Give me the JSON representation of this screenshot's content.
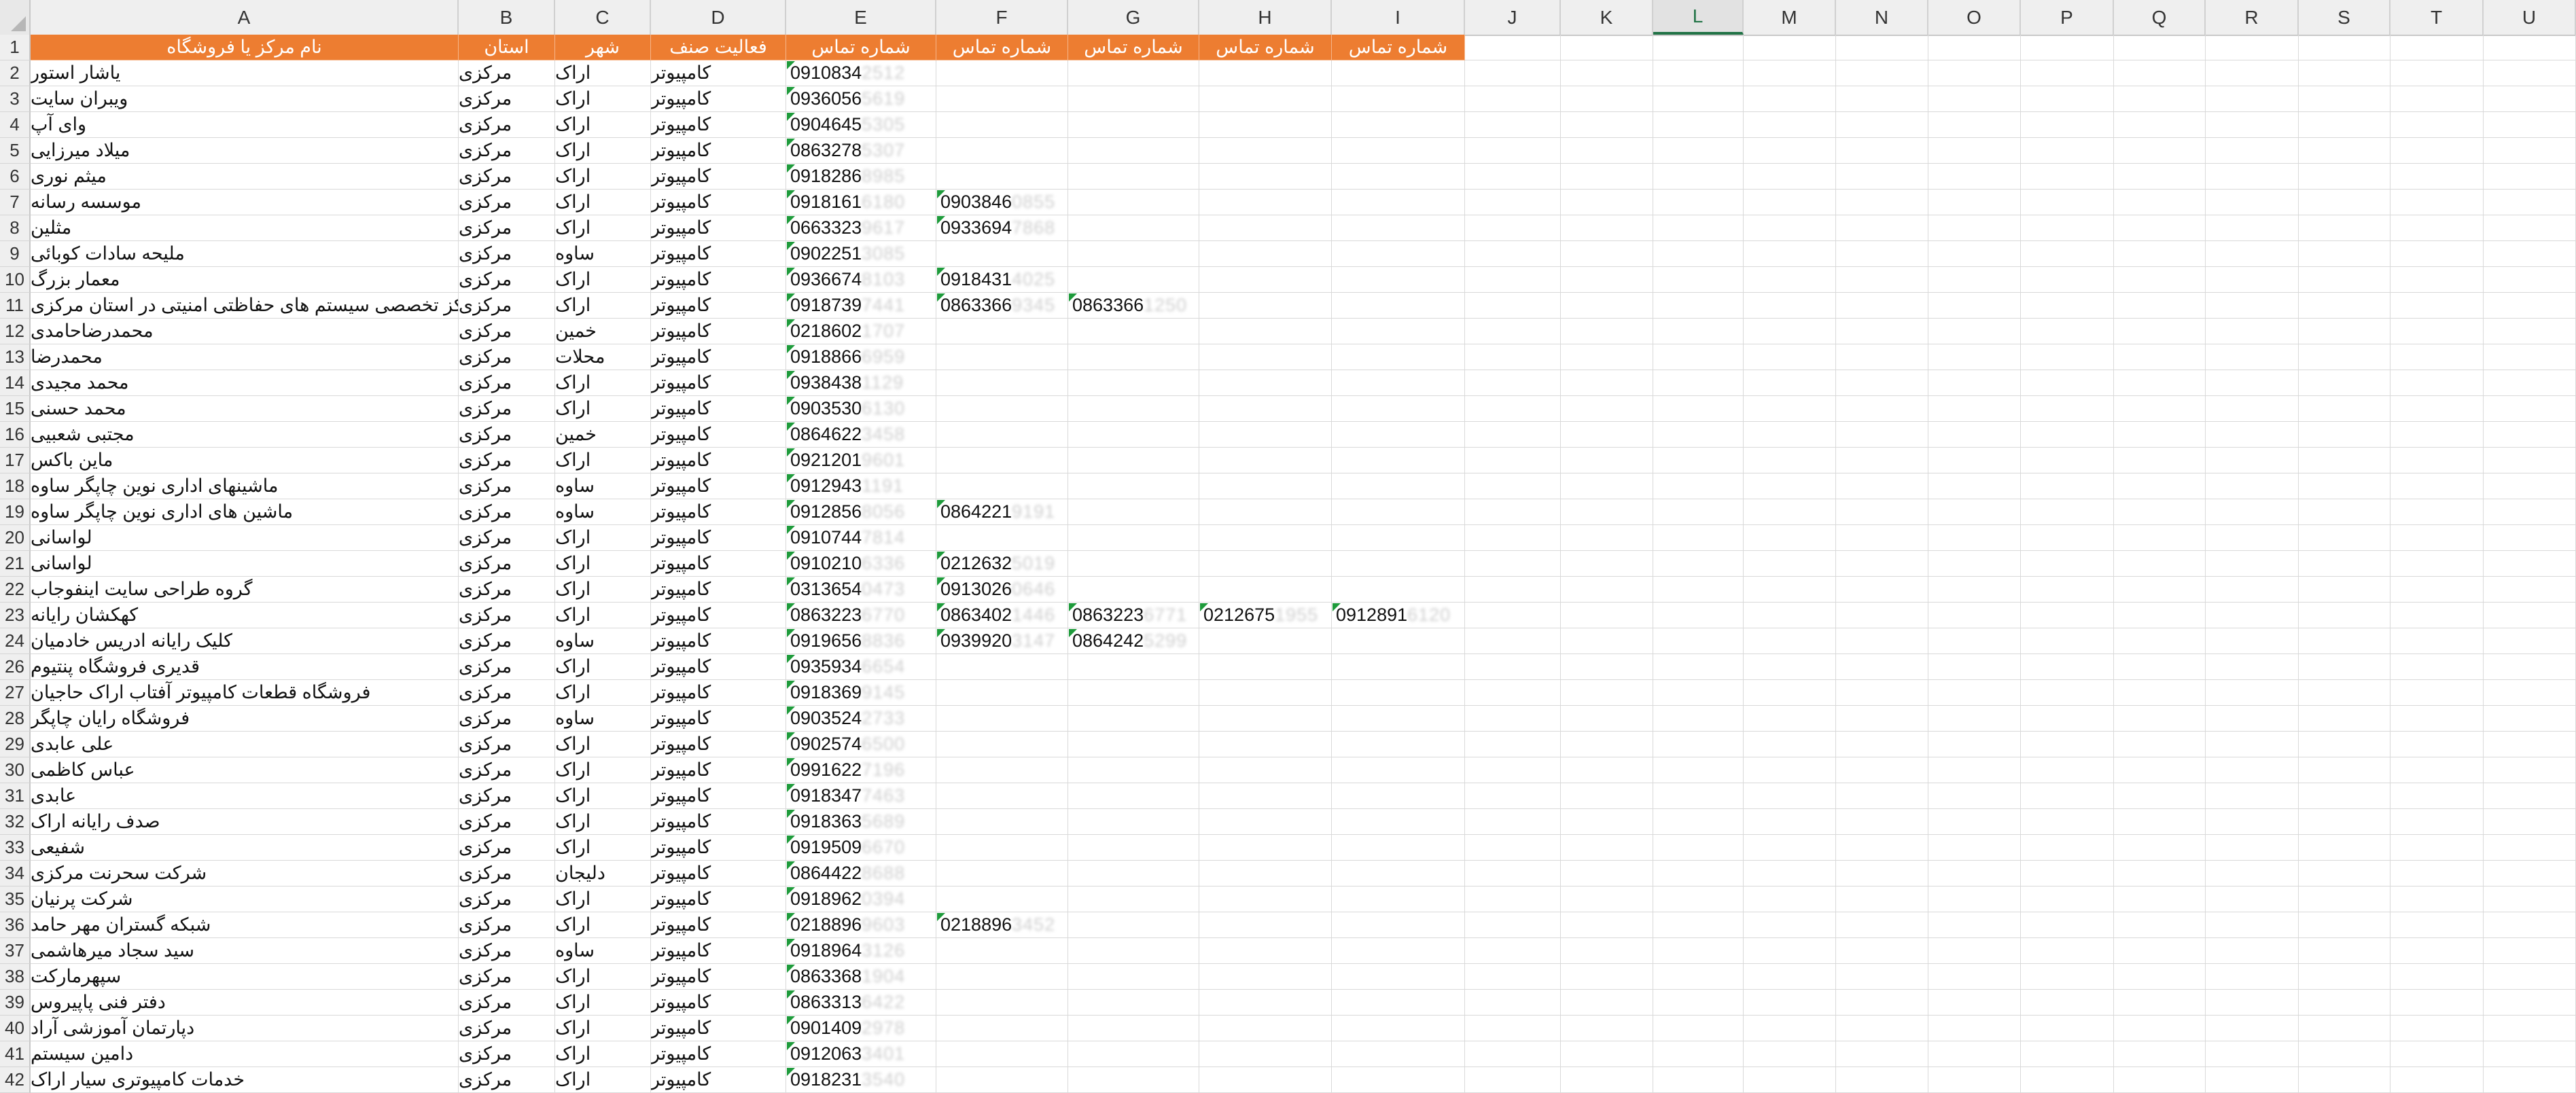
{
  "columns": [
    "A",
    "B",
    "C",
    "D",
    "E",
    "F",
    "G",
    "H",
    "I",
    "J",
    "K",
    "L",
    "M",
    "N",
    "O",
    "P",
    "Q",
    "R",
    "S",
    "T",
    "U"
  ],
  "selected_column": "L",
  "colors": {
    "header_fill": "#ed7d31",
    "header_text": "#ffffff",
    "indicator": "#1e9b3b",
    "selected": "#217346"
  },
  "header_row": [
    "نام مرکز یا فروشگاه",
    "استان",
    "شهر",
    "فعالیت صنف",
    "شماره تماس",
    "شماره تماس",
    "شماره تماس",
    "شماره تماس",
    "شماره تماس"
  ],
  "rows": [
    {
      "n": "2",
      "name": "یاشار استور",
      "prov": "مرکزی",
      "city": "اراک",
      "act": "کامپیوتر",
      "phones": [
        [
          "0910834",
          "2512"
        ]
      ]
    },
    {
      "n": "3",
      "name": "ویبران سایت",
      "prov": "مرکزی",
      "city": "اراک",
      "act": "کامپیوتر",
      "phones": [
        [
          "0936056",
          "5619"
        ]
      ]
    },
    {
      "n": "4",
      "name": "وای آپ",
      "prov": "مرکزی",
      "city": "اراک",
      "act": "کامپیوتر",
      "phones": [
        [
          "0904645",
          "5305"
        ]
      ]
    },
    {
      "n": "5",
      "name": "میلاد میرزایی",
      "prov": "مرکزی",
      "city": "اراک",
      "act": "کامپیوتر",
      "phones": [
        [
          "0863278",
          "5307"
        ]
      ]
    },
    {
      "n": "6",
      "name": "میثم نوری",
      "prov": "مرکزی",
      "city": "اراک",
      "act": "کامپیوتر",
      "phones": [
        [
          "0918286",
          "8985"
        ]
      ]
    },
    {
      "n": "7",
      "name": "موسسه رسانه",
      "prov": "مرکزی",
      "city": "اراک",
      "act": "کامپیوتر",
      "phones": [
        [
          "0918161",
          "6180"
        ],
        [
          "0903846",
          "0855"
        ]
      ]
    },
    {
      "n": "8",
      "name": "مثلین",
      "prov": "مرکزی",
      "city": "اراک",
      "act": "کامپیوتر",
      "phones": [
        [
          "0663323",
          "9617"
        ],
        [
          "0933694",
          "7868"
        ]
      ]
    },
    {
      "n": "9",
      "name": "ملیحه سادات کوبائی",
      "prov": "مرکزی",
      "city": "ساوه",
      "act": "کامپیوتر",
      "phones": [
        [
          "0902251",
          "3085"
        ]
      ]
    },
    {
      "n": "10",
      "name": "معمار بزرگ",
      "prov": "مرکزی",
      "city": "اراک",
      "act": "کامپیوتر",
      "phones": [
        [
          "0936674",
          "8103"
        ],
        [
          "0918431",
          "4025"
        ]
      ]
    },
    {
      "n": "11",
      "name": "مرکز تخصصی سیستم های حفاظتی امنیتی در استان مرکزی",
      "prov": "مرکزی",
      "city": "اراک",
      "act": "کامپیوتر",
      "phones": [
        [
          "0918739",
          "7441"
        ],
        [
          "0863366",
          "9345"
        ],
        [
          "0863366",
          "1250"
        ]
      ]
    },
    {
      "n": "12",
      "name": "محمدرضاحامدی",
      "prov": "مرکزی",
      "city": "خمین",
      "act": "کامپیوتر",
      "phones": [
        [
          "0218602",
          "1707"
        ]
      ]
    },
    {
      "n": "13",
      "name": "محمدرضا",
      "prov": "مرکزی",
      "city": "محلات",
      "act": "کامپیوتر",
      "phones": [
        [
          "0918866",
          "6959"
        ]
      ]
    },
    {
      "n": "14",
      "name": "محمد مجیدی",
      "prov": "مرکزی",
      "city": "اراک",
      "act": "کامپیوتر",
      "phones": [
        [
          "0938438",
          "1129"
        ]
      ]
    },
    {
      "n": "15",
      "name": "محمد حسنی",
      "prov": "مرکزی",
      "city": "اراک",
      "act": "کامپیوتر",
      "phones": [
        [
          "0903530",
          "6130"
        ]
      ]
    },
    {
      "n": "16",
      "name": "مجتبی شعبیی",
      "prov": "مرکزی",
      "city": "خمین",
      "act": "کامپیوتر",
      "phones": [
        [
          "0864622",
          "3458"
        ]
      ]
    },
    {
      "n": "17",
      "name": "ماین باکس",
      "prov": "مرکزی",
      "city": "اراک",
      "act": "کامپیوتر",
      "phones": [
        [
          "0921201",
          "9601"
        ]
      ]
    },
    {
      "n": "18",
      "name": "ماشینهای اداری نوین چاپگر ساوه",
      "prov": "مرکزی",
      "city": "ساوه",
      "act": "کامپیوتر",
      "phones": [
        [
          "0912943",
          "1191"
        ]
      ]
    },
    {
      "n": "19",
      "name": "ماشین های اداری نوین چاپگر ساوه",
      "prov": "مرکزی",
      "city": "ساوه",
      "act": "کامپیوتر",
      "phones": [
        [
          "0912856",
          "8056"
        ],
        [
          "0864221",
          "9191"
        ]
      ]
    },
    {
      "n": "20",
      "name": "لواسانی",
      "prov": "مرکزی",
      "city": "اراک",
      "act": "کامپیوتر",
      "phones": [
        [
          "0910744",
          "7814"
        ]
      ]
    },
    {
      "n": "21",
      "name": "لواسانی",
      "prov": "مرکزی",
      "city": "اراک",
      "act": "کامپیوتر",
      "phones": [
        [
          "0910210",
          "6336"
        ],
        [
          "0212632",
          "5019"
        ]
      ]
    },
    {
      "n": "22",
      "name": "گروه طراحی سایت اینفوجاب",
      "prov": "مرکزی",
      "city": "اراک",
      "act": "کامپیوتر",
      "phones": [
        [
          "0313654",
          "0473"
        ],
        [
          "0913026",
          "0646"
        ]
      ]
    },
    {
      "n": "23",
      "name": "کهکشان رایانه",
      "prov": "مرکزی",
      "city": "اراک",
      "act": "کامپیوتر",
      "phones": [
        [
          "0863223",
          "6770"
        ],
        [
          "0863402",
          "1446"
        ],
        [
          "0863223",
          "6771"
        ],
        [
          "0212675",
          "1955"
        ],
        [
          "0912891",
          "6120"
        ]
      ]
    },
    {
      "n": "24",
      "name": "کلیک رایانه ادریس خادمیان",
      "prov": "مرکزی",
      "city": "ساوه",
      "act": "کامپیوتر",
      "phones": [
        [
          "0919656",
          "8836"
        ],
        [
          "0939920",
          "3147"
        ],
        [
          "0864242",
          "5299"
        ]
      ]
    },
    {
      "n": "26",
      "name": "قدیری فروشگاه پنتیوم",
      "prov": "مرکزی",
      "city": "اراک",
      "act": "کامپیوتر",
      "phones": [
        [
          "0935934",
          "6654"
        ]
      ]
    },
    {
      "n": "27",
      "name": "فروشگاه قطعات کامپیوتر آفتاب اراک حاجیان",
      "prov": "مرکزی",
      "city": "اراک",
      "act": "کامپیوتر",
      "phones": [
        [
          "0918369",
          "9145"
        ]
      ]
    },
    {
      "n": "28",
      "name": "فروشگاه رایان چاپگر",
      "prov": "مرکزی",
      "city": "ساوه",
      "act": "کامپیوتر",
      "phones": [
        [
          "0903524",
          "2733"
        ]
      ]
    },
    {
      "n": "29",
      "name": "علی عابدی",
      "prov": "مرکزی",
      "city": "اراک",
      "act": "کامپیوتر",
      "phones": [
        [
          "0902574",
          "6500"
        ]
      ]
    },
    {
      "n": "30",
      "name": "عباس کاظمی",
      "prov": "مرکزی",
      "city": "اراک",
      "act": "کامپیوتر",
      "phones": [
        [
          "0991622",
          "7196"
        ]
      ]
    },
    {
      "n": "31",
      "name": "عابدی",
      "prov": "مرکزی",
      "city": "اراک",
      "act": "کامپیوتر",
      "phones": [
        [
          "0918347",
          "7463"
        ]
      ]
    },
    {
      "n": "32",
      "name": "صدف رایانه اراک",
      "prov": "مرکزی",
      "city": "اراک",
      "act": "کامپیوتر",
      "phones": [
        [
          "0918363",
          "5689"
        ]
      ]
    },
    {
      "n": "33",
      "name": "شفیعی",
      "prov": "مرکزی",
      "city": "اراک",
      "act": "کامپیوتر",
      "phones": [
        [
          "0919509",
          "6670"
        ]
      ]
    },
    {
      "n": "34",
      "name": "شرکت سحرنت  مرکزی",
      "prov": "مرکزی",
      "city": "دلیجان",
      "act": "کامپیوتر",
      "phones": [
        [
          "0864422",
          "8688"
        ]
      ]
    },
    {
      "n": "35",
      "name": "شرکت پرنیان",
      "prov": "مرکزی",
      "city": "اراک",
      "act": "کامپیوتر",
      "phones": [
        [
          "0918962",
          "0394"
        ]
      ]
    },
    {
      "n": "36",
      "name": "شبکه گستران مهر حامد",
      "prov": "مرکزی",
      "city": "اراک",
      "act": "کامپیوتر",
      "phones": [
        [
          "0218896",
          "9603"
        ],
        [
          "0218896",
          "3452"
        ]
      ]
    },
    {
      "n": "37",
      "name": "سید سجاد میرهاشمی",
      "prov": "مرکزی",
      "city": "ساوه",
      "act": "کامپیوتر",
      "phones": [
        [
          "0918964",
          "3126"
        ]
      ]
    },
    {
      "n": "38",
      "name": "سپهرمارکت",
      "prov": "مرکزی",
      "city": "اراک",
      "act": "کامپیوتر",
      "phones": [
        [
          "0863368",
          "1904"
        ]
      ]
    },
    {
      "n": "39",
      "name": "دفتر فنی پاپیروس",
      "prov": "مرکزی",
      "city": "اراک",
      "act": "کامپیوتر",
      "phones": [
        [
          "0863313",
          "6422"
        ]
      ]
    },
    {
      "n": "40",
      "name": "دپارتمان آموزشی آراد",
      "prov": "مرکزی",
      "city": "اراک",
      "act": "کامپیوتر",
      "phones": [
        [
          "0901409",
          "2978"
        ]
      ]
    },
    {
      "n": "41",
      "name": "دامین سیستم",
      "prov": "مرکزی",
      "city": "اراک",
      "act": "کامپیوتر",
      "phones": [
        [
          "0912063",
          "3401"
        ]
      ]
    },
    {
      "n": "42",
      "name": "خدمات کامپیوتری سیار اراک",
      "prov": "مرکزی",
      "city": "اراک",
      "act": "کامپیوتر",
      "phones": [
        [
          "0918231",
          "3540"
        ]
      ]
    }
  ]
}
